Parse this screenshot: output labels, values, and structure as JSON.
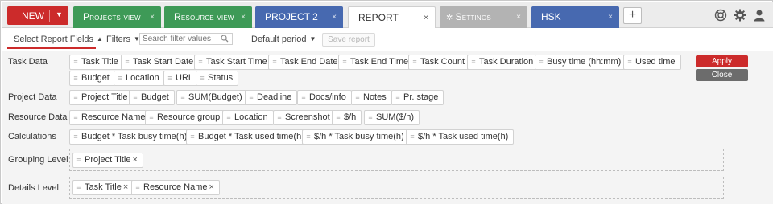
{
  "tabbar": {
    "new_label": "NEW",
    "tabs": [
      {
        "label": "Projects view",
        "close": "×"
      },
      {
        "label": "Resource view",
        "close": "×"
      },
      {
        "label": "PROJECT 2",
        "close": "×"
      },
      {
        "label": "REPORT",
        "close": "×"
      },
      {
        "label": "Settings",
        "close": "×"
      },
      {
        "label": "HSK",
        "close": "×"
      }
    ],
    "add_label": "+",
    "icons": [
      "help-lifebuoy-icon",
      "gear-icon",
      "user-icon"
    ]
  },
  "toolbar": {
    "select_fields": "Select Report Fields",
    "filters": "Filters",
    "search_placeholder": "Search filter values",
    "default_period": "Default period",
    "save_report": "Save report"
  },
  "sections": {
    "task_data": {
      "label": "Task Data",
      "fields": [
        "Task Title",
        "Task Start Date",
        "Task Start Time",
        "Task End Date",
        "Task End Time",
        "Task Count",
        "Task Duration",
        "Busy time (hh:mm)",
        "Used time",
        "Budget",
        "Location",
        "URL",
        "Status"
      ]
    },
    "project_data": {
      "label": "Project Data",
      "fields": [
        "Project Title",
        "Budget",
        "SUM(Budget)",
        "Deadline",
        "Docs/info",
        "Notes",
        "Pr. stage"
      ]
    },
    "resource_data": {
      "label": "Resource Data",
      "fields": [
        "Resource Name",
        "Resource group",
        "Location",
        "Screenshot",
        "$/h",
        "SUM($/h)"
      ]
    },
    "calculations": {
      "label": "Calculations",
      "fields": [
        "Budget * Task busy time(h)",
        "Budget * Task used time(h)",
        "$/h * Task busy time(h)",
        "$/h * Task used time(h)"
      ]
    },
    "grouping": {
      "label": "Grouping Level",
      "items": [
        "Project Title"
      ]
    },
    "details": {
      "label": "Details Level",
      "items": [
        "Task Title",
        "Resource Name"
      ]
    }
  },
  "actions": {
    "apply": "Apply",
    "close": "Close"
  },
  "colors": {
    "accent_red": "#cc2b2b",
    "tab_green": "#3e9a57",
    "tab_blue": "#4769b0",
    "tab_gray": "#b3b3b3",
    "close_gray": "#6c6c6c"
  }
}
